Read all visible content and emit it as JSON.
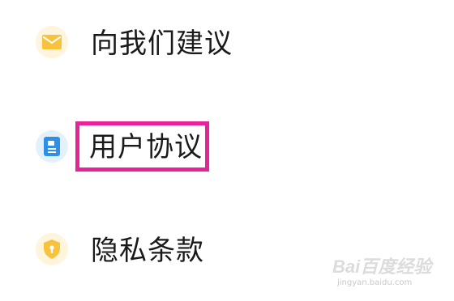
{
  "menu": {
    "items": [
      {
        "label": "向我们建议",
        "icon": "envelope-icon",
        "icon_color": "#f7c23e",
        "icon_bg": "#fff4dc"
      },
      {
        "label": "用户协议",
        "icon": "document-icon",
        "icon_color": "#2f8fe4",
        "icon_bg": "#e3f1fc"
      },
      {
        "label": "隐私条款",
        "icon": "shield-icon",
        "icon_color": "#f7c23e",
        "icon_bg": "#fff4dc"
      }
    ]
  },
  "annotation": {
    "highlight_color": "#e8229b",
    "highlighted_item": "用户协议"
  },
  "watermark": {
    "brand": "Bai百度经验",
    "url": "jingyan.baidu.com"
  }
}
